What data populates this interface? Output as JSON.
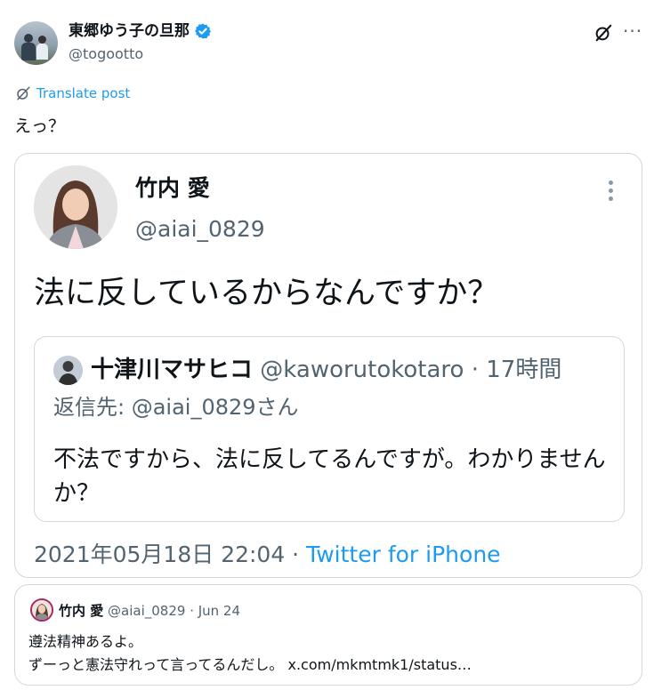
{
  "post": {
    "author_name": "東郷ゆう子の旦那",
    "author_handle": "@togootto",
    "translate_label": "Translate post",
    "text": "えっ？",
    "more_label": "···"
  },
  "embedded_tweet": {
    "author_name": "竹内 愛",
    "author_handle": "@aiai_0829",
    "text": "法に反しているからなんですか？",
    "quoted": {
      "author_name": "十津川マサヒコ",
      "author_handle": "@kaworutokotaro",
      "time": "· 17時間",
      "reply_to": "返信先: @aiai_0829さん",
      "text": "不法ですから、法に反してるんですが。わかりませんか？"
    },
    "timestamp": "2021年05月18日 22:04 · ",
    "source": "Twitter for iPhone"
  },
  "quoted_post": {
    "author_name": "竹内 愛",
    "author_handle": "@aiai_0829",
    "date": " · Jun 24",
    "line1": "遵法精神あるよ。",
    "line2": "ずーっと憲法守れって言ってるんだし。 x.com/mkmtmk1/status…"
  },
  "colors": {
    "accent": "#1d9bf0",
    "muted": "#536471",
    "border": "#cfd9de",
    "text": "#0f1419"
  },
  "icons": [
    "verified-badge-icon",
    "grok-icon",
    "more-icon",
    "translate-icon",
    "kebab-icon"
  ]
}
